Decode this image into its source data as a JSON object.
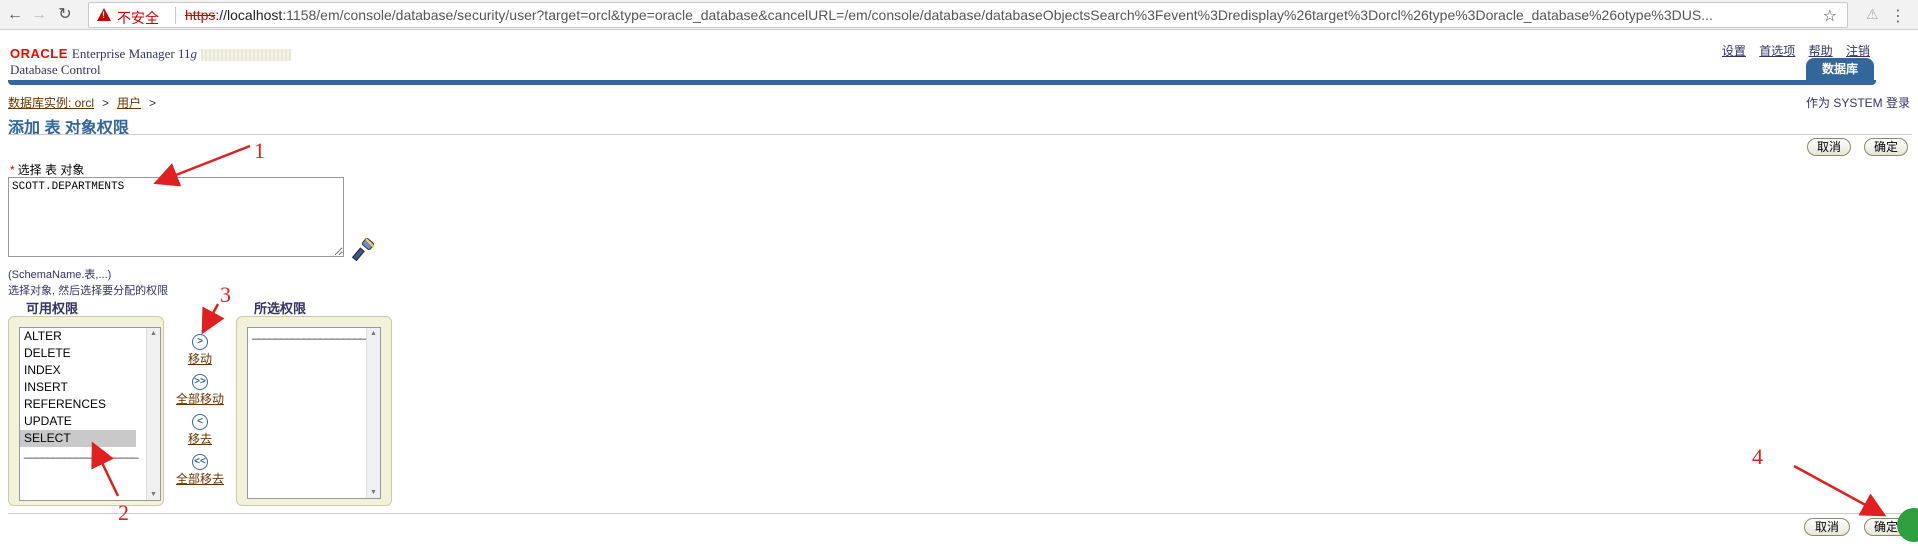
{
  "browser": {
    "insecure_label": "不安全",
    "url_scheme": "https",
    "url_host": "://localhost",
    "url_rest": ":1158/em/console/database/security/user?target=orcl&type=oracle_database&cancelURL=/em/console/database/databaseObjectsSearch%3Fevent%3Dredisplay%26target%3Dorcl%26type%3Doracle_database%26otype%3DUS..."
  },
  "header": {
    "oracle": "ORACLE",
    "em": "Enterprise Manager 11",
    "em_g": "g",
    "dc": "Database Control",
    "links": [
      "设置",
      "首选项",
      "帮助",
      "注销"
    ],
    "tab": "数据库"
  },
  "breadcrumb": {
    "instance": "数据库实例: orcl",
    "users": "用户",
    "sep": ">"
  },
  "login_as": "作为 SYSTEM 登录",
  "page_title": "添加 表 对象权限",
  "buttons": {
    "cancel": "取消",
    "ok": "确定"
  },
  "select_label": "选择 表 对象",
  "required_mark": "*",
  "object_value": "SCOTT.DEPARTMENTS",
  "hint_format": "(SchemaName.表,...)",
  "hint_instruction": "选择对象, 然后选择要分配的权限",
  "available": {
    "title": "可用权限",
    "options": [
      "ALTER",
      "DELETE",
      "INDEX",
      "INSERT",
      "REFERENCES",
      "UPDATE",
      "SELECT"
    ],
    "selected_option": "SELECT",
    "separator": "____________________"
  },
  "selected": {
    "title": "所选权限",
    "separator": "____________________"
  },
  "controls": {
    "move": "移动",
    "move_all": "全部移动",
    "remove": "移去",
    "remove_all": "全部移去"
  },
  "annotations": [
    "1",
    "2",
    "3",
    "4"
  ],
  "colors": {
    "brand_blue": "#336699",
    "oracle_red": "#ff0000",
    "annotation_red": "#e02020",
    "link_brown": "#663300",
    "panel_bg": "#f2f2dc"
  }
}
